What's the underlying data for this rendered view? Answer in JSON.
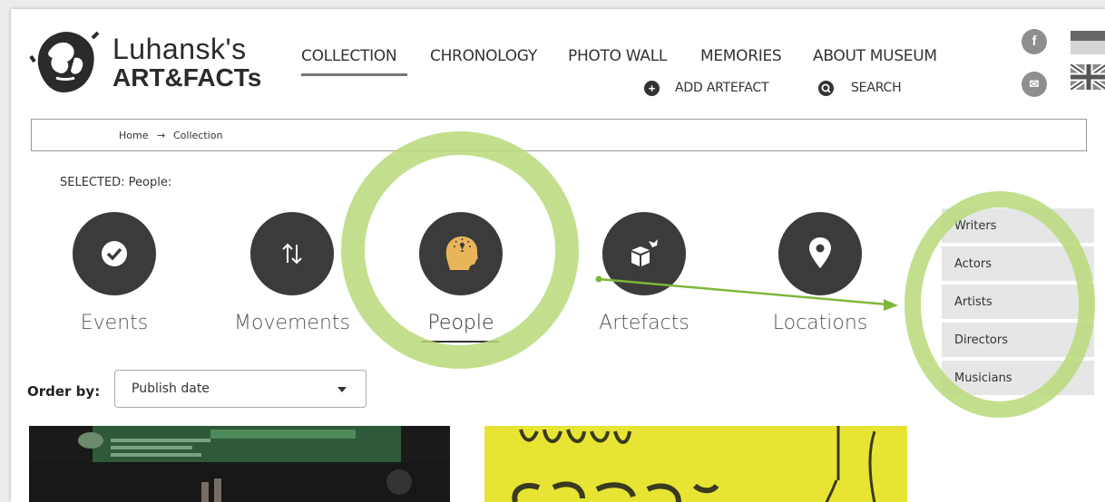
{
  "brand": {
    "line1": "Luhansk's",
    "line2": "ART&FACTs"
  },
  "nav": {
    "items": [
      "COLLECTION",
      "CHRONOLOGY",
      "PHOTO WALL",
      "MEMORIES",
      "ABOUT MUSEUM"
    ],
    "active": "COLLECTION"
  },
  "subnav": {
    "add": "ADD ARTEFACT",
    "search": "SEARCH"
  },
  "social": {
    "facebook": "f",
    "email": "✉"
  },
  "breadcrumb": {
    "home": "Home",
    "sep": "→",
    "current": "Collection"
  },
  "selected": "SELECTED: People:",
  "categories": [
    {
      "label": "Events",
      "icon": "checkmark-icon"
    },
    {
      "label": "Movements",
      "icon": "arrows-up-down-icon"
    },
    {
      "label": "People",
      "icon": "head-lightbulb-icon"
    },
    {
      "label": "Artefacts",
      "icon": "box-icon"
    },
    {
      "label": "Locations",
      "icon": "map-pin-icon"
    }
  ],
  "active_category": "People",
  "subcategories": [
    "Writers",
    "Actors",
    "Artists",
    "Directors",
    "Musicians"
  ],
  "order": {
    "label": "Order by:",
    "value": "Publish date"
  },
  "colors": {
    "highlight": "#b8d97a",
    "arrow": "#7db83a",
    "people_icon": "#e8b65a",
    "icon_bg": "#3b3b3b",
    "thumb2_bg": "#e8e433"
  }
}
